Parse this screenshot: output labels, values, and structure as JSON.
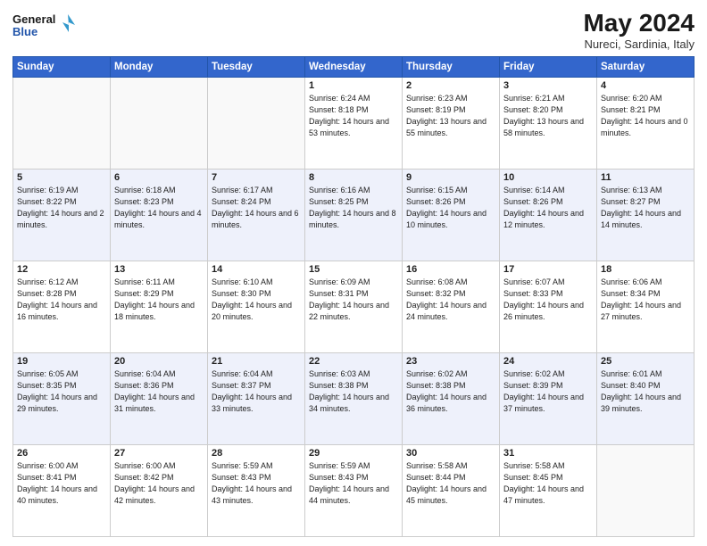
{
  "header": {
    "logo_line1": "General",
    "logo_line2": "Blue",
    "month_year": "May 2024",
    "location": "Nureci, Sardinia, Italy"
  },
  "weekdays": [
    "Sunday",
    "Monday",
    "Tuesday",
    "Wednesday",
    "Thursday",
    "Friday",
    "Saturday"
  ],
  "weeks": [
    [
      {
        "day": "",
        "sunrise": "",
        "sunset": "",
        "daylight": ""
      },
      {
        "day": "",
        "sunrise": "",
        "sunset": "",
        "daylight": ""
      },
      {
        "day": "",
        "sunrise": "",
        "sunset": "",
        "daylight": ""
      },
      {
        "day": "1",
        "sunrise": "Sunrise: 6:24 AM",
        "sunset": "Sunset: 8:18 PM",
        "daylight": "Daylight: 14 hours and 53 minutes."
      },
      {
        "day": "2",
        "sunrise": "Sunrise: 6:23 AM",
        "sunset": "Sunset: 8:19 PM",
        "daylight": "Daylight: 13 hours and 55 minutes."
      },
      {
        "day": "3",
        "sunrise": "Sunrise: 6:21 AM",
        "sunset": "Sunset: 8:20 PM",
        "daylight": "Daylight: 13 hours and 58 minutes."
      },
      {
        "day": "4",
        "sunrise": "Sunrise: 6:20 AM",
        "sunset": "Sunset: 8:21 PM",
        "daylight": "Daylight: 14 hours and 0 minutes."
      }
    ],
    [
      {
        "day": "5",
        "sunrise": "Sunrise: 6:19 AM",
        "sunset": "Sunset: 8:22 PM",
        "daylight": "Daylight: 14 hours and 2 minutes."
      },
      {
        "day": "6",
        "sunrise": "Sunrise: 6:18 AM",
        "sunset": "Sunset: 8:23 PM",
        "daylight": "Daylight: 14 hours and 4 minutes."
      },
      {
        "day": "7",
        "sunrise": "Sunrise: 6:17 AM",
        "sunset": "Sunset: 8:24 PM",
        "daylight": "Daylight: 14 hours and 6 minutes."
      },
      {
        "day": "8",
        "sunrise": "Sunrise: 6:16 AM",
        "sunset": "Sunset: 8:25 PM",
        "daylight": "Daylight: 14 hours and 8 minutes."
      },
      {
        "day": "9",
        "sunrise": "Sunrise: 6:15 AM",
        "sunset": "Sunset: 8:26 PM",
        "daylight": "Daylight: 14 hours and 10 minutes."
      },
      {
        "day": "10",
        "sunrise": "Sunrise: 6:14 AM",
        "sunset": "Sunset: 8:26 PM",
        "daylight": "Daylight: 14 hours and 12 minutes."
      },
      {
        "day": "11",
        "sunrise": "Sunrise: 6:13 AM",
        "sunset": "Sunset: 8:27 PM",
        "daylight": "Daylight: 14 hours and 14 minutes."
      }
    ],
    [
      {
        "day": "12",
        "sunrise": "Sunrise: 6:12 AM",
        "sunset": "Sunset: 8:28 PM",
        "daylight": "Daylight: 14 hours and 16 minutes."
      },
      {
        "day": "13",
        "sunrise": "Sunrise: 6:11 AM",
        "sunset": "Sunset: 8:29 PM",
        "daylight": "Daylight: 14 hours and 18 minutes."
      },
      {
        "day": "14",
        "sunrise": "Sunrise: 6:10 AM",
        "sunset": "Sunset: 8:30 PM",
        "daylight": "Daylight: 14 hours and 20 minutes."
      },
      {
        "day": "15",
        "sunrise": "Sunrise: 6:09 AM",
        "sunset": "Sunset: 8:31 PM",
        "daylight": "Daylight: 14 hours and 22 minutes."
      },
      {
        "day": "16",
        "sunrise": "Sunrise: 6:08 AM",
        "sunset": "Sunset: 8:32 PM",
        "daylight": "Daylight: 14 hours and 24 minutes."
      },
      {
        "day": "17",
        "sunrise": "Sunrise: 6:07 AM",
        "sunset": "Sunset: 8:33 PM",
        "daylight": "Daylight: 14 hours and 26 minutes."
      },
      {
        "day": "18",
        "sunrise": "Sunrise: 6:06 AM",
        "sunset": "Sunset: 8:34 PM",
        "daylight": "Daylight: 14 hours and 27 minutes."
      }
    ],
    [
      {
        "day": "19",
        "sunrise": "Sunrise: 6:05 AM",
        "sunset": "Sunset: 8:35 PM",
        "daylight": "Daylight: 14 hours and 29 minutes."
      },
      {
        "day": "20",
        "sunrise": "Sunrise: 6:04 AM",
        "sunset": "Sunset: 8:36 PM",
        "daylight": "Daylight: 14 hours and 31 minutes."
      },
      {
        "day": "21",
        "sunrise": "Sunrise: 6:04 AM",
        "sunset": "Sunset: 8:37 PM",
        "daylight": "Daylight: 14 hours and 33 minutes."
      },
      {
        "day": "22",
        "sunrise": "Sunrise: 6:03 AM",
        "sunset": "Sunset: 8:38 PM",
        "daylight": "Daylight: 14 hours and 34 minutes."
      },
      {
        "day": "23",
        "sunrise": "Sunrise: 6:02 AM",
        "sunset": "Sunset: 8:38 PM",
        "daylight": "Daylight: 14 hours and 36 minutes."
      },
      {
        "day": "24",
        "sunrise": "Sunrise: 6:02 AM",
        "sunset": "Sunset: 8:39 PM",
        "daylight": "Daylight: 14 hours and 37 minutes."
      },
      {
        "day": "25",
        "sunrise": "Sunrise: 6:01 AM",
        "sunset": "Sunset: 8:40 PM",
        "daylight": "Daylight: 14 hours and 39 minutes."
      }
    ],
    [
      {
        "day": "26",
        "sunrise": "Sunrise: 6:00 AM",
        "sunset": "Sunset: 8:41 PM",
        "daylight": "Daylight: 14 hours and 40 minutes."
      },
      {
        "day": "27",
        "sunrise": "Sunrise: 6:00 AM",
        "sunset": "Sunset: 8:42 PM",
        "daylight": "Daylight: 14 hours and 42 minutes."
      },
      {
        "day": "28",
        "sunrise": "Sunrise: 5:59 AM",
        "sunset": "Sunset: 8:43 PM",
        "daylight": "Daylight: 14 hours and 43 minutes."
      },
      {
        "day": "29",
        "sunrise": "Sunrise: 5:59 AM",
        "sunset": "Sunset: 8:43 PM",
        "daylight": "Daylight: 14 hours and 44 minutes."
      },
      {
        "day": "30",
        "sunrise": "Sunrise: 5:58 AM",
        "sunset": "Sunset: 8:44 PM",
        "daylight": "Daylight: 14 hours and 45 minutes."
      },
      {
        "day": "31",
        "sunrise": "Sunrise: 5:58 AM",
        "sunset": "Sunset: 8:45 PM",
        "daylight": "Daylight: 14 hours and 47 minutes."
      },
      {
        "day": "",
        "sunrise": "",
        "sunset": "",
        "daylight": ""
      }
    ]
  ]
}
